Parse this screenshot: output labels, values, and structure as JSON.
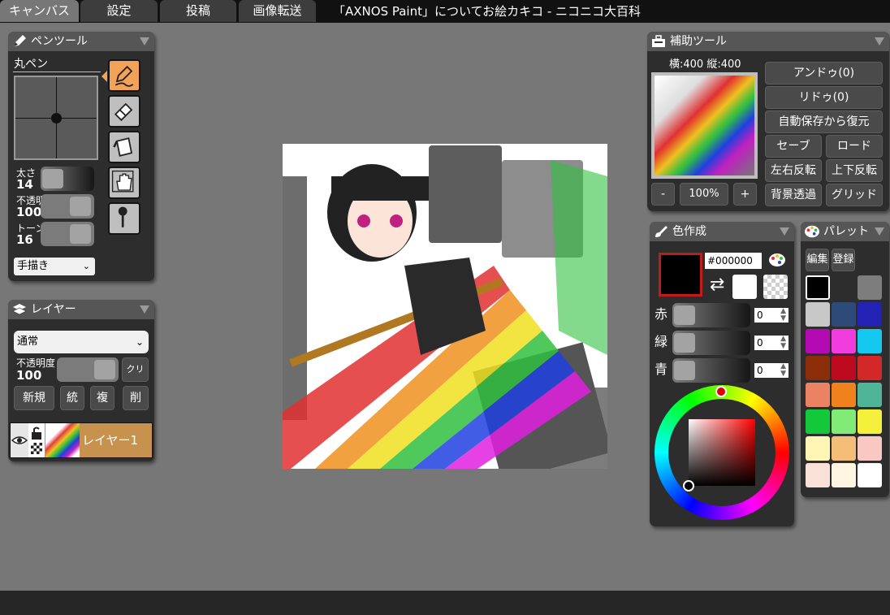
{
  "tabs": [
    {
      "label": "キャンバス",
      "active": true
    },
    {
      "label": "設定",
      "active": false
    },
    {
      "label": "投稿",
      "active": false
    },
    {
      "label": "画像転送",
      "active": false
    }
  ],
  "document_title": "「AXNOS Paint」についてお絵カキコ - ニコニコ大百科",
  "pen_tool": {
    "title": "ペンツール",
    "brush_name": "丸ペン",
    "size_label": "太さ",
    "size_value": "14",
    "opacity_label": "不透明度",
    "opacity_value": "100",
    "tone_label": "トーン濃度",
    "tone_value": "16",
    "mode_select": "手描き",
    "tools": [
      "pen-icon",
      "eraser-icon",
      "bucket-icon",
      "hand-icon",
      "dropper-icon"
    ]
  },
  "layer_panel": {
    "title": "レイヤー",
    "blend_select": "通常",
    "opacity_label": "不透明度",
    "opacity_value": "100",
    "clear_label": "クリア",
    "buttons": [
      "新規",
      "統",
      "複",
      "削"
    ],
    "layer_name": "レイヤー1"
  },
  "aux_panel": {
    "title": "補助ツール",
    "size_text": "横:400 縦:400",
    "zoom_minus": "-",
    "zoom_value": "100%",
    "zoom_plus": "+",
    "undo": "アンドゥ(0)",
    "redo": "リドゥ(0)",
    "restore": "自動保存から復元",
    "save": "セーブ",
    "load": "ロード",
    "flip_h": "左右反転",
    "flip_v": "上下反転",
    "bg_transparent": "背景透過",
    "grid": "グリッド"
  },
  "color_panel": {
    "title": "色作成",
    "hex_value": "#000000",
    "current_color": "#000000",
    "red_label": "赤",
    "green_label": "緑",
    "blue_label": "青",
    "red_value": "0",
    "green_value": "0",
    "blue_value": "0"
  },
  "palette_panel": {
    "title": "パレット",
    "edit_label": "編集",
    "register_label": "登録",
    "colors": [
      "#000000",
      "#2d2d2d",
      "#7d7d7d",
      "#c8c8c8",
      "#2e4a78",
      "#2222b4",
      "#b40ab4",
      "#f03cdc",
      "#14c8f0",
      "#8c2d0a",
      "#be0a1e",
      "#d22828",
      "#eb8264",
      "#f0821e",
      "#50b496",
      "#14c83c",
      "#82eb78",
      "#f5f03c",
      "#fff5b4",
      "#f5be78",
      "#fac8c3",
      "#fae1d7",
      "#fff5e1",
      "#ffffff"
    ]
  }
}
